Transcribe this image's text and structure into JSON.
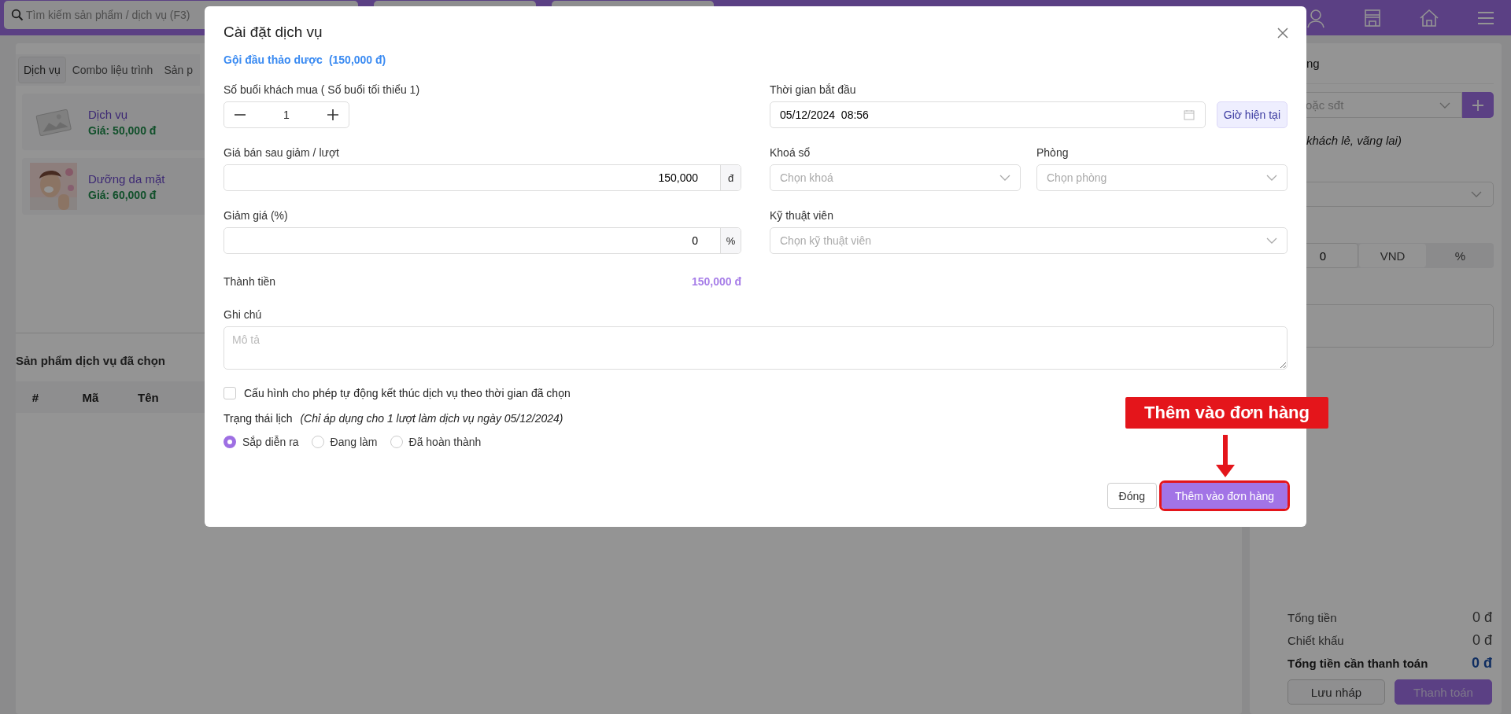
{
  "topbar": {
    "search": {
      "placeholder": "Tìm kiếm sản phẩm / dịch vụ (F3)"
    }
  },
  "left_panel": {
    "tabs": [
      {
        "label": "Dịch vụ",
        "selected": true
      },
      {
        "label": "Combo liệu trình",
        "selected": false
      },
      {
        "label": "Sản p",
        "selected": false
      }
    ],
    "products": [
      {
        "name": "Dịch vụ",
        "price": "Giá: 50,000 đ",
        "kind": "placeholder"
      },
      {
        "name": "Dưỡng da mặt",
        "price": "Giá: 60,000 đ",
        "kind": "picture"
      }
    ],
    "selected_title": "Sản phẩm dịch vụ đã chọn",
    "table": {
      "columns": [
        "#",
        "Mã",
        "Tên"
      ]
    }
  },
  "right_panel": {
    "heading": "ng",
    "customer": {
      "placeholder": "oặc sđt"
    },
    "customer_note": "khách lẻ, vãng lai)",
    "discount": {
      "value": "0",
      "units": [
        {
          "label": "VND",
          "selected": true
        },
        {
          "label": "%",
          "selected": false
        }
      ]
    },
    "totals": [
      {
        "label": "Tổng tiền",
        "value": "0 đ",
        "kind": "normal"
      },
      {
        "label": "Chiết khấu",
        "value": "0 đ",
        "kind": "normal"
      },
      {
        "label": "Tổng tiền cần thanh toán",
        "value": "0 đ",
        "kind": "grand"
      }
    ],
    "buttons": [
      {
        "label": "Lưu nháp",
        "kind": "secondary"
      },
      {
        "label": "Thanh toán",
        "kind": "primary"
      }
    ]
  },
  "modal": {
    "title": "Cài đặt dịch vụ",
    "service_name": "Gội đầu thảo dược",
    "service_price": "(150,000 đ)",
    "sessions": {
      "label": "Số buổi khách mua ( Số buổi tối thiểu 1)",
      "value": "1"
    },
    "start_time": {
      "label": "Thời gian bắt đầu",
      "value": "05/12/2024  08:56",
      "now_button": "Giờ hiện tại"
    },
    "price": {
      "label": "Giá bán sau giảm / lượt",
      "value": "150,000",
      "unit": "đ"
    },
    "lock": {
      "label": "Khoá sổ",
      "placeholder": "Chọn khoá"
    },
    "room": {
      "label": "Phòng",
      "placeholder": "Chọn phòng"
    },
    "discount": {
      "label": "Giảm giá (%)",
      "value": "0",
      "unit": "%"
    },
    "technician": {
      "label": "Kỹ thuật viên",
      "placeholder": "Chọn kỹ thuật viên"
    },
    "total": {
      "label": "Thành tiền",
      "value": "150,000 đ"
    },
    "note": {
      "label": "Ghi chú",
      "placeholder": "Mô tả"
    },
    "auto_finish": {
      "label": "Cấu hình cho phép tự động kết thúc dịch vụ theo thời gian đã chọn",
      "checked": false
    },
    "status": {
      "label": "Trạng thái lịch",
      "hint": "(Chỉ áp dụng cho 1 lượt làm dịch vụ ngày 05/12/2024)",
      "options": [
        {
          "label": "Sắp diễn ra",
          "selected": true
        },
        {
          "label": "Đang làm",
          "selected": false
        },
        {
          "label": "Đã hoàn thành",
          "selected": false
        }
      ]
    },
    "buttons": [
      {
        "label": "Đóng",
        "kind": "secondary",
        "highlighted": false
      },
      {
        "label": "Thêm vào đơn hàng",
        "kind": "primary",
        "highlighted": true
      }
    ]
  },
  "callout": {
    "text": "Thêm vào đơn hàng"
  }
}
